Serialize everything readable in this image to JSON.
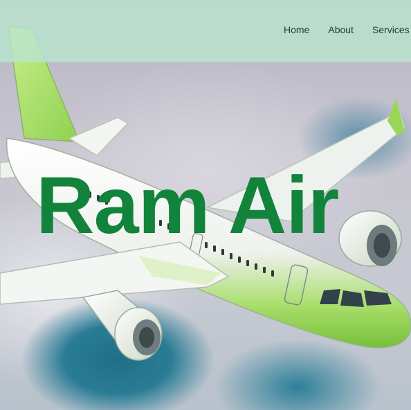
{
  "nav": {
    "links": [
      {
        "label": "Home"
      },
      {
        "label": "About"
      },
      {
        "label": "Services"
      }
    ]
  },
  "hero": {
    "headline": "Ram Air",
    "image": {
      "subject": "green-and-white passenger jet flying above clouds"
    }
  },
  "colors": {
    "nav_background": "#b8e4ce",
    "nav_text": "#1f3b2e",
    "headline": "#12833a",
    "plane_body": "#f3f5f2",
    "plane_accent": "#8fd14f"
  }
}
